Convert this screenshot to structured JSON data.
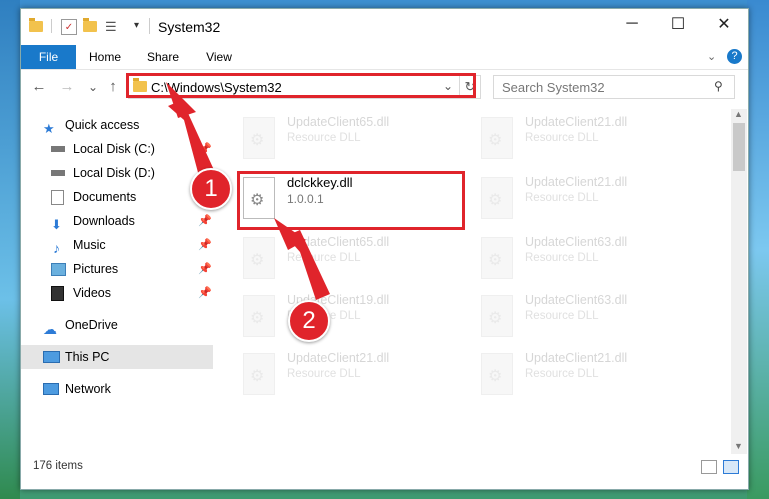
{
  "window": {
    "title": "System32",
    "minimize": "─",
    "maximize": "☐",
    "close": "✕"
  },
  "ribbon": {
    "tabs": [
      "File",
      "Home",
      "Share",
      "View"
    ],
    "help": "?"
  },
  "nav": {
    "back": "←",
    "forward": "→",
    "recent": "⌄",
    "up": "↑",
    "address": "C:\\Windows\\System32",
    "refresh": "↻",
    "search_placeholder": "Search System32"
  },
  "sidebar": {
    "items": [
      {
        "label": "Quick access",
        "icon": "star-icon",
        "pinned": false
      },
      {
        "label": "Local Disk (C:)",
        "icon": "drive-icon",
        "pinned": true
      },
      {
        "label": "Local Disk (D:)",
        "icon": "drive-icon",
        "pinned": true
      },
      {
        "label": "Documents",
        "icon": "documents-icon",
        "pinned": true
      },
      {
        "label": "Downloads",
        "icon": "download-icon",
        "pinned": true
      },
      {
        "label": "Music",
        "icon": "music-icon",
        "pinned": true
      },
      {
        "label": "Pictures",
        "icon": "pictures-icon",
        "pinned": true
      },
      {
        "label": "Videos",
        "icon": "video-icon",
        "pinned": true
      },
      {
        "label": "OneDrive",
        "icon": "cloud-icon",
        "pinned": false
      },
      {
        "label": "This PC",
        "icon": "computer-icon",
        "pinned": false
      },
      {
        "label": "Network",
        "icon": "network-icon",
        "pinned": false
      }
    ],
    "pin_glyph": "📌"
  },
  "files": [
    {
      "name": "UpdateClient65.dll",
      "desc": "Resource DLL"
    },
    {
      "name": "UpdateClient21.dll",
      "desc": "Resource DLL"
    },
    {
      "name": "dclckkey.dll",
      "desc": "1.0.0.1"
    },
    {
      "name": "UpdateClient21.dll",
      "desc": "Resource DLL"
    },
    {
      "name": "UpdateClient65.dll",
      "desc": "Resource DLL"
    },
    {
      "name": "UpdateClient63.dll",
      "desc": "Resource DLL"
    },
    {
      "name": "UpdateClient19.dll",
      "desc": "Resource DLL"
    },
    {
      "name": "UpdateClient63.dll",
      "desc": "Resource DLL"
    },
    {
      "name": "UpdateClient21.dll",
      "desc": "Resource DLL"
    },
    {
      "name": "UpdateClient21.dll",
      "desc": "Resource DLL"
    }
  ],
  "status": {
    "items_count": "176 items"
  },
  "annotations": {
    "badge1": "1",
    "badge2": "2",
    "color": "#e0242b"
  }
}
